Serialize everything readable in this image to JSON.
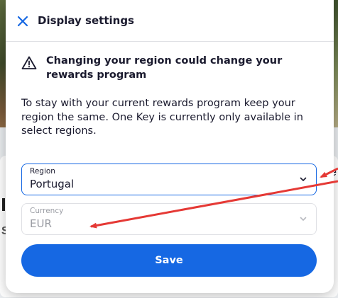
{
  "modal": {
    "title": "Display settings",
    "warning": "Changing your region could change your rewards program",
    "body": "To stay with your current rewards program keep your region the same. One Key is currently only available in select regions.",
    "save_label": "Save"
  },
  "region": {
    "label": "Region",
    "value": "Portugal"
  },
  "currency": {
    "label": "Currency",
    "value": "EUR",
    "disabled": true
  },
  "background": {
    "text_e": "e",
    "text_s": "S"
  },
  "icons": {
    "close": "close-icon",
    "warning": "warning-triangle-icon",
    "chevron": "chevron-down-icon"
  },
  "colors": {
    "accent": "#1668e3",
    "annotation": "#e53935",
    "text": "#1a1a2e",
    "disabled": "#9a9ca3"
  }
}
